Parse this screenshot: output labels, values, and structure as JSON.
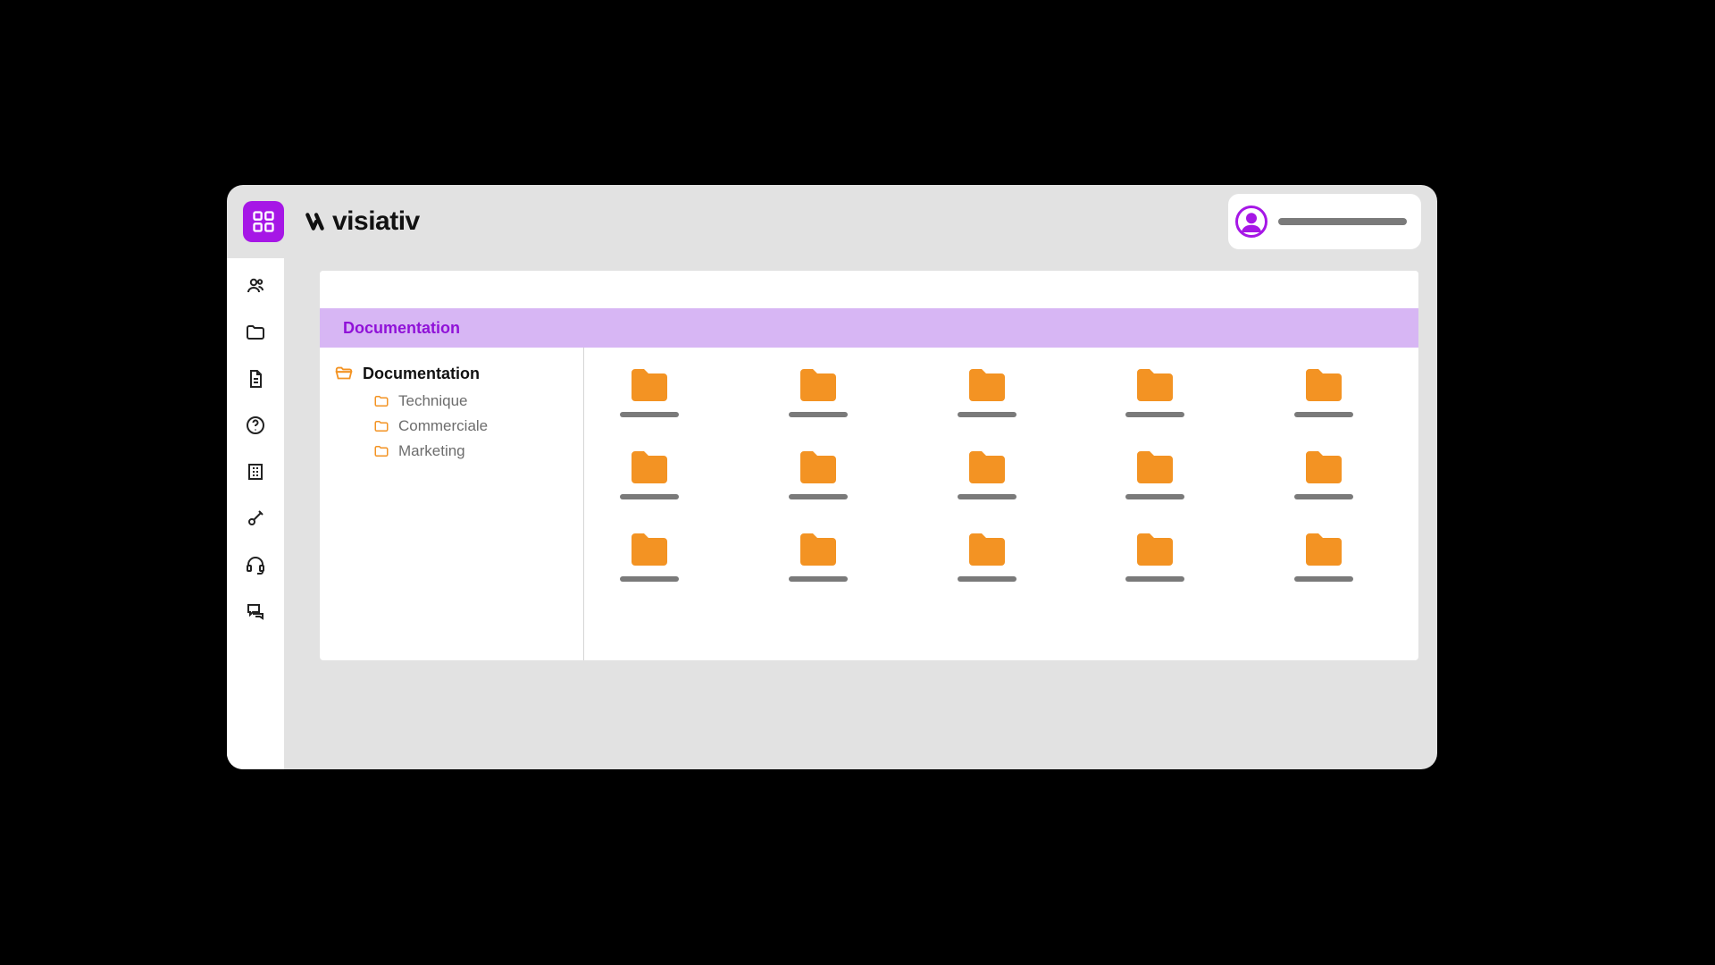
{
  "brand": {
    "name": "visiativ"
  },
  "colors": {
    "accent_purple": "#A617E6",
    "breadcrumb_bg": "#D7B6F4",
    "breadcrumb_text": "#9012D8",
    "folder_orange": "#F39323",
    "placeholder_gray": "#7a7a7a"
  },
  "sidebar": {
    "items": [
      {
        "icon": "users-icon"
      },
      {
        "icon": "folder-icon"
      },
      {
        "icon": "document-icon"
      },
      {
        "icon": "help-icon"
      },
      {
        "icon": "building-icon"
      },
      {
        "icon": "tools-icon"
      },
      {
        "icon": "headset-icon"
      },
      {
        "icon": "chat-icon"
      }
    ]
  },
  "breadcrumb": {
    "label": "Documentation"
  },
  "tree": {
    "root": {
      "label": "Documentation"
    },
    "children": [
      {
        "label": "Technique"
      },
      {
        "label": "Commerciale"
      },
      {
        "label": "Marketing"
      }
    ]
  },
  "grid": {
    "folder_count": 15
  }
}
